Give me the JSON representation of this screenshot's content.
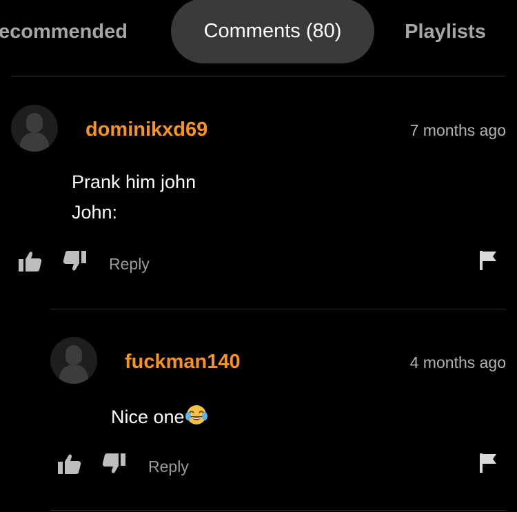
{
  "tabs": {
    "recommended": "ecommended",
    "comments": "Comments (80)",
    "playlists": "Playlists"
  },
  "comments": [
    {
      "username": "dominikxd69",
      "time": "7 months ago",
      "lines": [
        "Prank him john",
        "John:"
      ],
      "reply_label": "Reply"
    },
    {
      "username": "fuckman140",
      "time": "4 months ago",
      "lines": [
        "Nice one"
      ],
      "emoji": "face-with-tears-of-joy-emoji",
      "reply_label": "Reply"
    }
  ],
  "colors": {
    "background": "#000000",
    "username": "#f7941d",
    "active_tab": "#3a3a3a",
    "muted_text": "#9a9a9a"
  }
}
